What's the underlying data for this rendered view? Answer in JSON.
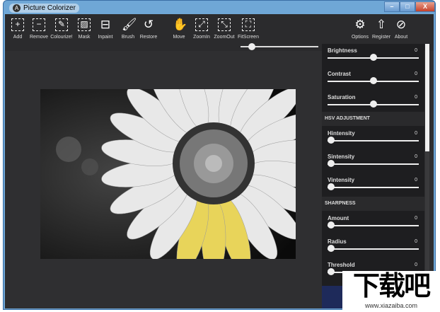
{
  "window": {
    "title": "Picture Colorizer",
    "minimize": "–",
    "maximize": "□",
    "close": "X"
  },
  "toolbar": [
    {
      "id": "add",
      "label": "Add",
      "icon": "+"
    },
    {
      "id": "remove",
      "label": "Remove",
      "icon": "−"
    },
    {
      "id": "colourize",
      "label": "Colourize!",
      "icon": "✎"
    },
    {
      "id": "mask",
      "label": "Mask",
      "icon": "▨"
    },
    {
      "id": "inpaint",
      "label": "Inpaint",
      "icon": "⊟"
    },
    {
      "id": "brush",
      "label": "Brush",
      "icon": "🖌"
    },
    {
      "id": "restore",
      "label": "Restore",
      "icon": "↺"
    },
    {
      "id": "move",
      "label": "Move",
      "icon": "✋"
    },
    {
      "id": "zoomin",
      "label": "ZoomIn",
      "icon": "⤢"
    },
    {
      "id": "zoomout",
      "label": "ZoomOut",
      "icon": "⤡"
    },
    {
      "id": "fitscreen",
      "label": "FitScreen",
      "icon": "⛶"
    },
    {
      "id": "options",
      "label": "Options",
      "icon": "⚙"
    },
    {
      "id": "register",
      "label": "Register",
      "icon": "⇧"
    },
    {
      "id": "about",
      "label": "About",
      "icon": "⊘"
    }
  ],
  "zoom_level": 0.1,
  "panel": {
    "basic": [
      {
        "label": "Brightness",
        "value": "0",
        "pos": 0.5
      },
      {
        "label": "Contrast",
        "value": "0",
        "pos": 0.5
      },
      {
        "label": "Saturation",
        "value": "0",
        "pos": 0.5
      }
    ],
    "hsv_header": "HSV ADJUSTMENT",
    "hsv": [
      {
        "label": "Hintensity",
        "value": "0",
        "pos": 0
      },
      {
        "label": "Sintensity",
        "value": "0",
        "pos": 0
      },
      {
        "label": "Vintensity",
        "value": "0",
        "pos": 0
      }
    ],
    "sharp_header": "SHARPNESS",
    "sharp": [
      {
        "label": "Amount",
        "value": "0",
        "pos": 0
      },
      {
        "label": "Radius",
        "value": "0",
        "pos": 0
      },
      {
        "label": "Threshold",
        "value": "0",
        "pos": 0
      }
    ]
  },
  "watermark": {
    "big": "下载吧",
    "url": "www.xiazaiba.com"
  }
}
